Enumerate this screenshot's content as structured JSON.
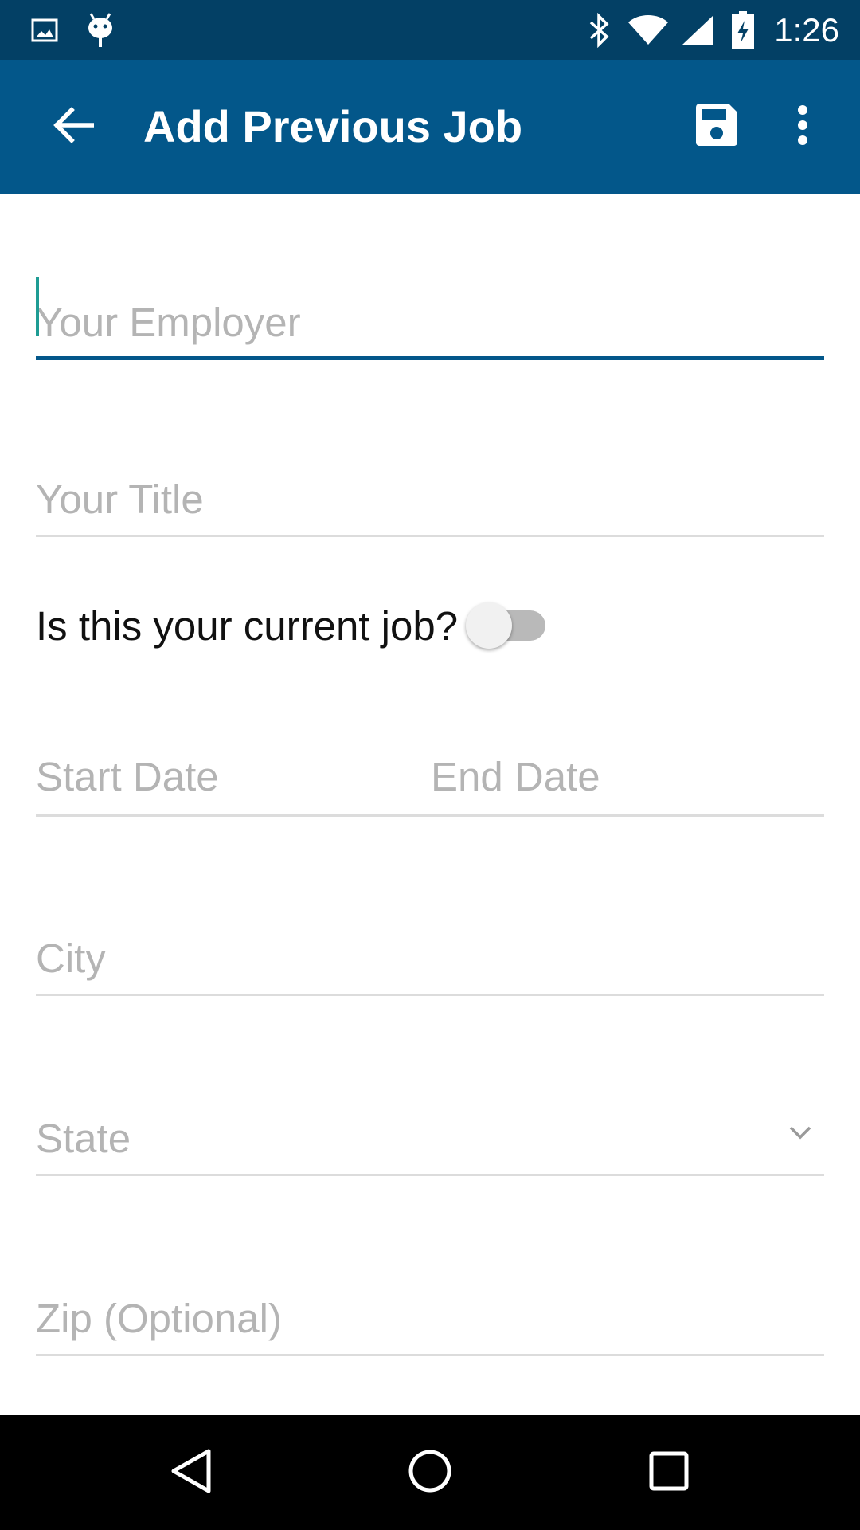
{
  "status_bar": {
    "time": "1:26",
    "icons": [
      "image-icon",
      "android-icon",
      "bluetooth-icon",
      "wifi-icon",
      "cell-signal-icon",
      "battery-charging-icon"
    ]
  },
  "app_bar": {
    "title": "Add Previous Job",
    "back_icon": "arrow-left-icon",
    "save_icon": "floppy-disk-icon",
    "more_icon": "more-vertical-icon",
    "background_color": "#03578a"
  },
  "form": {
    "employer": {
      "value": "",
      "placeholder": "Your Employer"
    },
    "title": {
      "value": "",
      "placeholder": "Your Title"
    },
    "current_job": {
      "label": "Is this your current job?",
      "checked": false
    },
    "start_date": {
      "placeholder": "Start Date"
    },
    "end_date": {
      "placeholder": "End Date"
    },
    "city": {
      "value": "",
      "placeholder": "City"
    },
    "state": {
      "placeholder": "State",
      "icon": "chevron-down-icon"
    },
    "zip": {
      "value": "",
      "placeholder": "Zip (Optional)"
    }
  },
  "nav_bar": {
    "icons": [
      "back-triangle-icon",
      "home-circle-icon",
      "recents-square-icon"
    ]
  }
}
